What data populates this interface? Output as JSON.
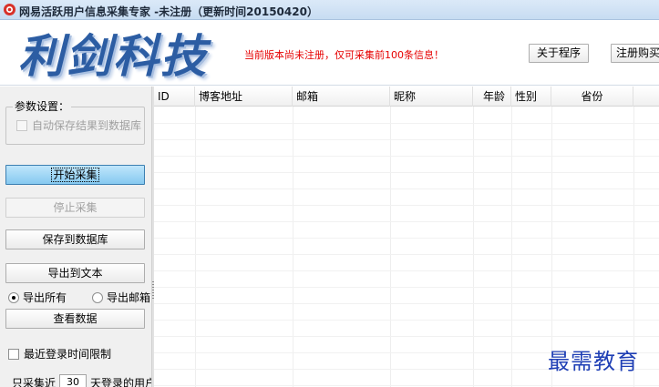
{
  "window": {
    "title": "网易活跃用户信息采集专家 -未注册（更新时间20150420）"
  },
  "header": {
    "logo_text": "利剑科技",
    "notice": "当前版本尚未注册，仅可采集前100条信息！",
    "about_button": "关于程序",
    "register_button": "注册购买"
  },
  "sidebar": {
    "params_group": "参数设置：",
    "auto_save": {
      "label": "自动保存结果到数据库",
      "checked": false,
      "enabled": false
    },
    "start_button": "开始采集",
    "stop_button": "停止采集",
    "save_db_button": "保存到数据库",
    "export_text_button": "导出到文本",
    "export_all_radio": "导出所有",
    "export_email_radio": "导出邮箱",
    "view_data_button": "查看数据",
    "login_limit_checkbox": "最近登录时间限制",
    "days_prefix": "只采集近",
    "days_value": "30",
    "days_suffix": "天登录的用户"
  },
  "grid": {
    "columns": [
      "ID",
      "博客地址",
      "邮箱",
      "昵称",
      "年龄",
      "性别",
      "省份"
    ],
    "rows": []
  },
  "watermark": "最需教育"
}
